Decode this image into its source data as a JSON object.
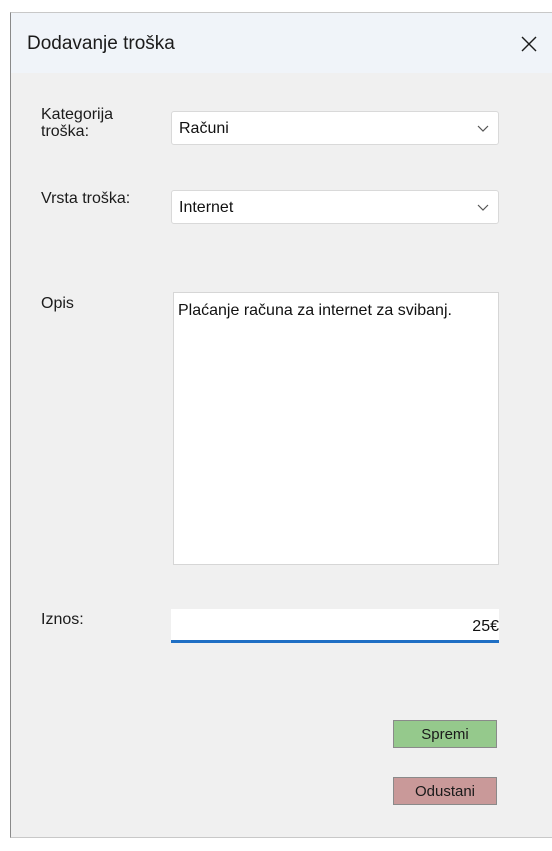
{
  "window": {
    "title": "Dodavanje troška"
  },
  "form": {
    "category_label_line1": "Kategorija",
    "category_label_line2": "troška:",
    "category_value": "Računi",
    "type_label": "Vrsta troška:",
    "type_value": "Internet",
    "description_label": "Opis",
    "description_value": "Plaćanje računa za internet za svibanj.",
    "amount_label": "Iznos:",
    "amount_value": "25€"
  },
  "buttons": {
    "save_label": "Spremi",
    "cancel_label": "Odustani"
  },
  "icons": {
    "close": "close-icon",
    "dropdown": "chevron-down-icon"
  },
  "colors": {
    "save_button": "#95c98c",
    "cancel_button": "#c99999",
    "focus_underline": "#1f6fc4"
  }
}
